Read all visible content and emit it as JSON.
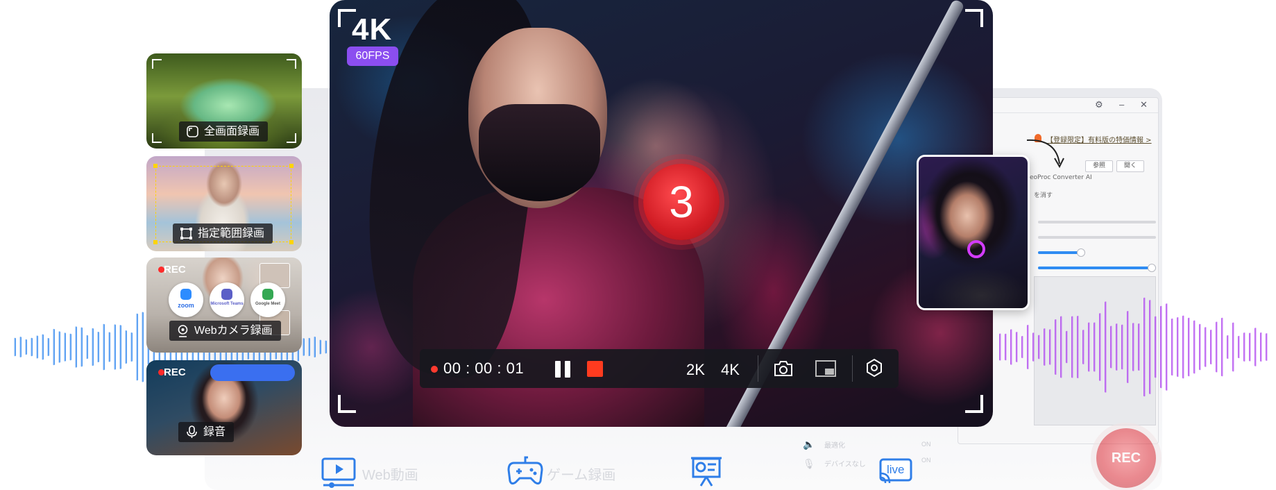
{
  "preview": {
    "resolution_badge": "4K",
    "fps_badge": "60FPS",
    "countdown": "3"
  },
  "toolbar": {
    "timer": "00 : 00 : 01",
    "resolution_2k": "2K",
    "resolution_4k": "4K",
    "icons": [
      "record-dot-icon",
      "pause-icon",
      "stop-icon",
      "camera-icon",
      "pip-icon",
      "settings-icon"
    ],
    "accent_color": "#ff3b1f"
  },
  "modes": [
    {
      "label": "全画面録画",
      "icon": "fullscreen-icon"
    },
    {
      "label": "指定範囲録画",
      "icon": "region-select-icon"
    },
    {
      "label": "Webカメラ録画",
      "icon": "webcam-icon",
      "rec": "REC"
    },
    {
      "label": "録音",
      "icon": "microphone-icon",
      "rec": "REC"
    }
  ],
  "conference_apps": [
    {
      "name": "zoom",
      "color": "#2d8cff"
    },
    {
      "name": "Microsoft Teams",
      "color": "#5b5fc7"
    },
    {
      "name": "Google Meet",
      "color": "#34a853"
    }
  ],
  "app_window": {
    "promo": "【登録限定】有料版の特価情報 >",
    "browse_button": "参照",
    "open_button": "開く",
    "product_name": "eoProc Converter AI",
    "hint": "を消す",
    "option_optimize": "最適化",
    "option_device": "デバイスなし",
    "on_label_1": "ON",
    "on_label_2": "ON",
    "rec_button": "REC"
  },
  "features": [
    {
      "label": "Web動画",
      "icon": "monitor-play-icon"
    },
    {
      "label": "ゲーム録画",
      "icon": "gamepad-icon"
    },
    {
      "label": "",
      "icon": "presentation-icon"
    },
    {
      "label": "live",
      "icon": "live-stream-icon"
    }
  ],
  "colors": {
    "fps_badge": "#8b4ef0",
    "wave_left": "#3b8df0",
    "wave_right": "#b34ef0",
    "countdown": "#d21d25"
  }
}
